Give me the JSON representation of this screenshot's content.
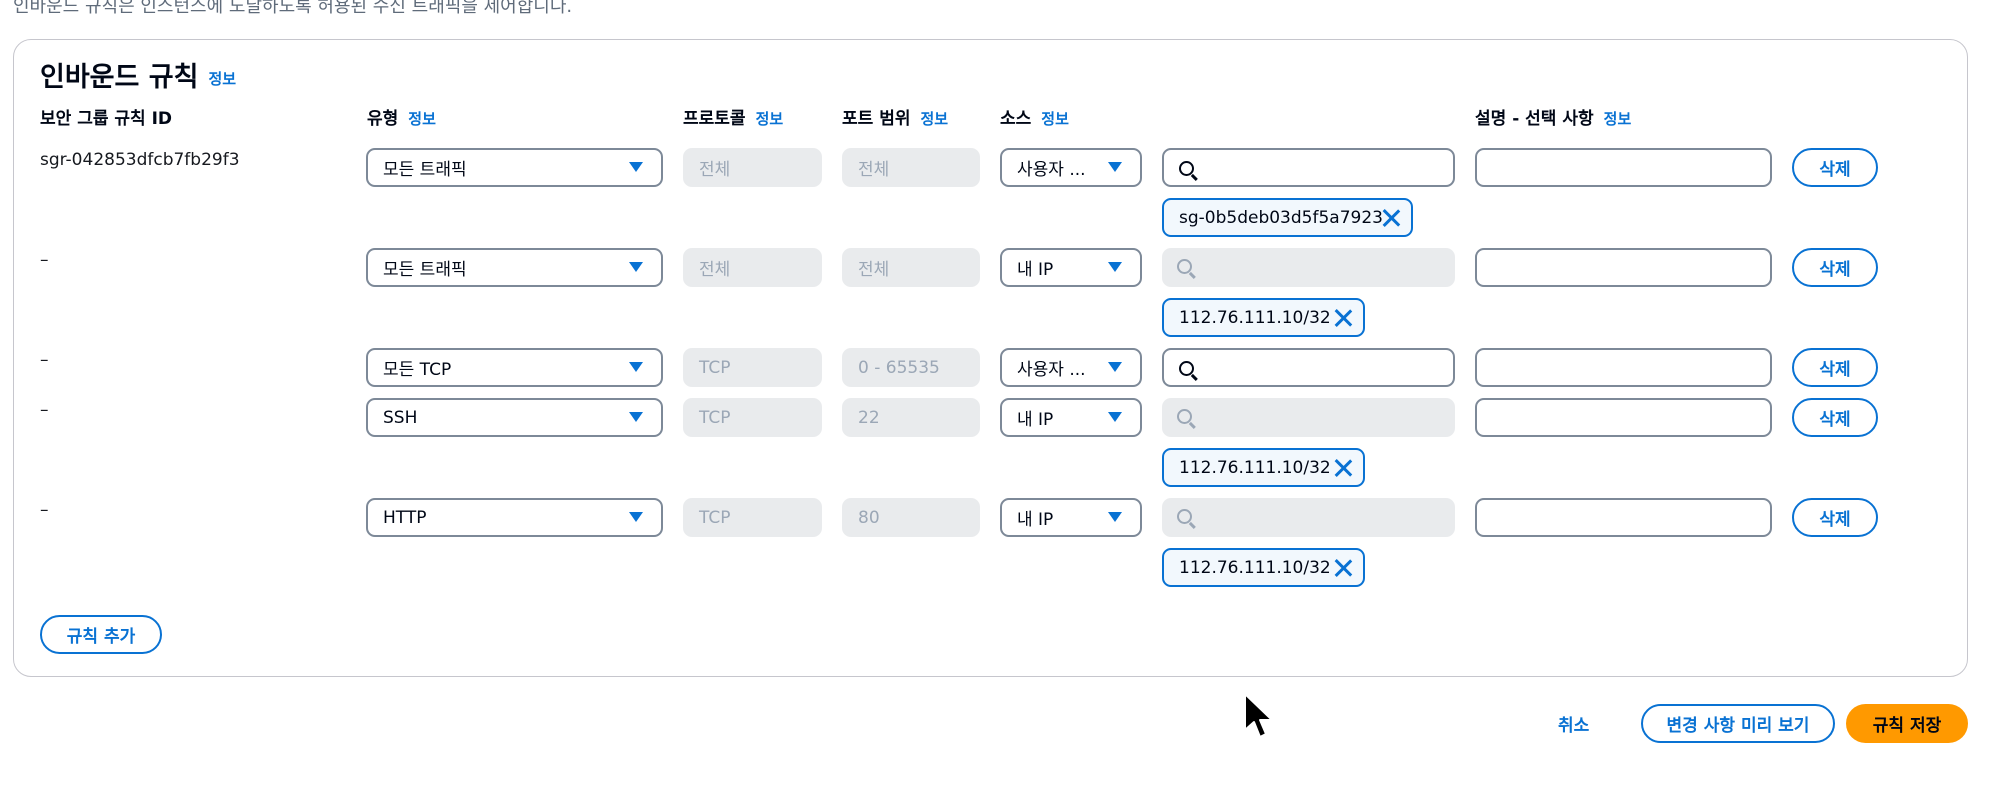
{
  "page": {
    "top_description": "인바운드 규칙은 인스턴스에 도달하도록 허용된 수신 트래픽을 제어합니다."
  },
  "panel": {
    "title": "인바운드 규칙",
    "info_label": "정보",
    "columns": {
      "rule_id": "보안 그룹 규칙 ID",
      "type": "유형",
      "protocol": "프로토콜",
      "port_range": "포트 범위",
      "source": "소스",
      "description": "설명 - 선택 사항"
    }
  },
  "rules": [
    {
      "id": "sgr-042853dfcb7fb29f3",
      "type": "모든 트래픽",
      "protocol": "전체",
      "port": "전체",
      "source": "사용자 ...",
      "token": "sg-0b5deb03d5f5a7923"
    },
    {
      "id": "–",
      "type": "모든 트래픽",
      "protocol": "전체",
      "port": "전체",
      "source": "내 IP",
      "token": "112.76.111.10/32"
    },
    {
      "id": "–",
      "type": "모든 TCP",
      "protocol": "TCP",
      "port": "0 - 65535",
      "source": "사용자 ...",
      "token": ""
    },
    {
      "id": "–",
      "type": "SSH",
      "protocol": "TCP",
      "port": "22",
      "source": "내 IP",
      "token": "112.76.111.10/32"
    },
    {
      "id": "–",
      "type": "HTTP",
      "protocol": "TCP",
      "port": "80",
      "source": "내 IP",
      "token": "112.76.111.10/32"
    }
  ],
  "actions": {
    "delete_label": "삭제",
    "add_rule_label": "규칙 추가",
    "cancel_label": "취소",
    "preview_label": "변경 사항 미리 보기",
    "save_label": "규칙 저장"
  },
  "colors": {
    "accent": "#0972d3",
    "primary_button": "#ff9900",
    "disabled_bg": "#e9ebed"
  }
}
